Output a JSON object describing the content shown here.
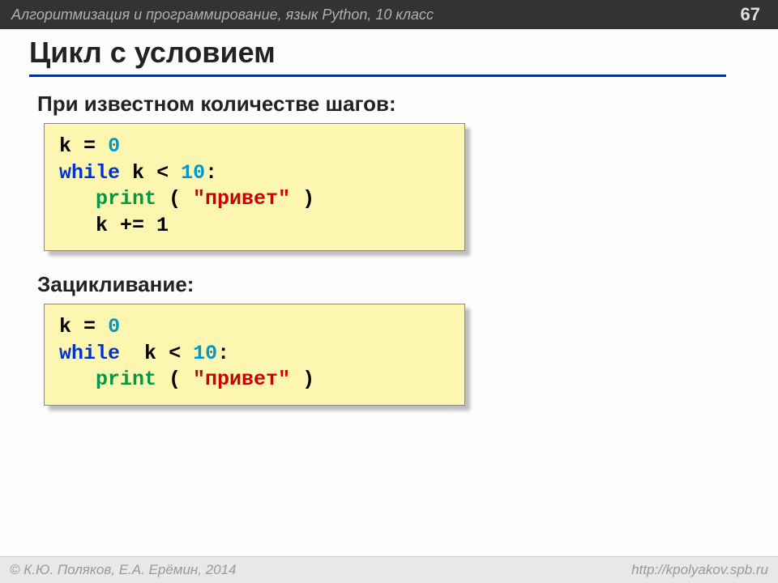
{
  "header": {
    "course": "Алгоритмизация и программирование, язык Python, 10 класс",
    "page": "67"
  },
  "title": "Цикл с условием",
  "section1": {
    "heading": "При известном количестве шагов:",
    "code": {
      "l1_k": "k",
      "l1_eq": "=",
      "l1_zero": "0",
      "l2_while": "while",
      "l2_k": "k",
      "l2_lt": "<",
      "l2_ten": "10",
      "l2_colon": ":",
      "l3_print": "print",
      "l3_open": " ( ",
      "l3_str": "\"привет\"",
      "l3_close": " )",
      "l4_incr": "k += 1"
    }
  },
  "section2": {
    "heading": "Зацикливание:",
    "code": {
      "l1_k": "k",
      "l1_eq": "=",
      "l1_zero": "0",
      "l2_while": "while",
      "l2_k": "k",
      "l2_lt": "<",
      "l2_ten": "10",
      "l2_colon": ":",
      "l3_print": "print",
      "l3_open": " ( ",
      "l3_str": "\"привет\"",
      "l3_close": " )"
    }
  },
  "footer": {
    "copyright_sym": "©",
    "authors": " К.Ю. Поляков, Е.А. Ерёмин, 2014",
    "url": "http://kpolyakov.spb.ru"
  }
}
